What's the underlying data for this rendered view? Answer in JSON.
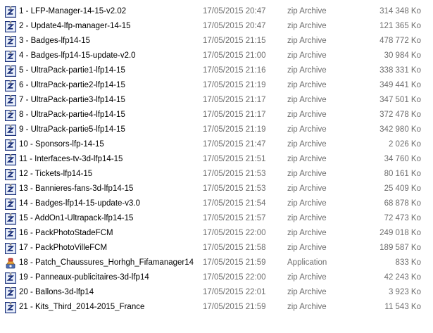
{
  "files": [
    {
      "name": "1 - LFP-Manager-14-15-v2.02",
      "date": "17/05/2015 20:47",
      "type": "zip Archive",
      "size": "314 348 Ko",
      "icon": "zip-archive-icon"
    },
    {
      "name": "2 - Update4-lfp-manager-14-15",
      "date": "17/05/2015 20:47",
      "type": "zip Archive",
      "size": "121 365 Ko",
      "icon": "zip-archive-icon"
    },
    {
      "name": "3 - Badges-lfp14-15",
      "date": "17/05/2015 21:15",
      "type": "zip Archive",
      "size": "478 772 Ko",
      "icon": "zip-archive-icon"
    },
    {
      "name": "4 - Badges-lfp14-15-update-v2.0",
      "date": "17/05/2015 21:00",
      "type": "zip Archive",
      "size": "30 984 Ko",
      "icon": "zip-archive-icon"
    },
    {
      "name": "5 - UltraPack-partie1-lfp14-15",
      "date": "17/05/2015 21:16",
      "type": "zip Archive",
      "size": "338 331 Ko",
      "icon": "zip-archive-icon"
    },
    {
      "name": "6 - UltraPack-partie2-lfp14-15",
      "date": "17/05/2015 21:19",
      "type": "zip Archive",
      "size": "349 441 Ko",
      "icon": "zip-archive-icon"
    },
    {
      "name": "7 - UltraPack-partie3-lfp14-15",
      "date": "17/05/2015 21:17",
      "type": "zip Archive",
      "size": "347 501 Ko",
      "icon": "zip-archive-icon"
    },
    {
      "name": "8 - UltraPack-partie4-lfp14-15",
      "date": "17/05/2015 21:17",
      "type": "zip Archive",
      "size": "372 478 Ko",
      "icon": "zip-archive-icon"
    },
    {
      "name": "9 - UltraPack-partie5-lfp14-15",
      "date": "17/05/2015 21:19",
      "type": "zip Archive",
      "size": "342 980 Ko",
      "icon": "zip-archive-icon"
    },
    {
      "name": "10 - Sponsors-lfp-14-15",
      "date": "17/05/2015 21:47",
      "type": "zip Archive",
      "size": "2 026 Ko",
      "icon": "zip-archive-icon"
    },
    {
      "name": "11 - Interfaces-tv-3d-lfp14-15",
      "date": "17/05/2015 21:51",
      "type": "zip Archive",
      "size": "34 760 Ko",
      "icon": "zip-archive-icon"
    },
    {
      "name": "12 - Tickets-lfp14-15",
      "date": "17/05/2015 21:53",
      "type": "zip Archive",
      "size": "80 161 Ko",
      "icon": "zip-archive-icon"
    },
    {
      "name": "13 - Bannieres-fans-3d-lfp14-15",
      "date": "17/05/2015 21:53",
      "type": "zip Archive",
      "size": "25 409 Ko",
      "icon": "zip-archive-icon"
    },
    {
      "name": "14 - Badges-lfp14-15-update-v3.0",
      "date": "17/05/2015 21:54",
      "type": "zip Archive",
      "size": "68 878 Ko",
      "icon": "zip-archive-icon"
    },
    {
      "name": "15 - AddOn1-Ultrapack-lfp14-15",
      "date": "17/05/2015 21:57",
      "type": "zip Archive",
      "size": "72 473 Ko",
      "icon": "zip-archive-icon"
    },
    {
      "name": "16 - PackPhotoStadeFCM",
      "date": "17/05/2015 22:00",
      "type": "zip Archive",
      "size": "249 018 Ko",
      "icon": "zip-archive-icon"
    },
    {
      "name": "17 - PackPhotoVilleFCM",
      "date": "17/05/2015 21:58",
      "type": "zip Archive",
      "size": "189 587 Ko",
      "icon": "zip-archive-icon"
    },
    {
      "name": "18 - Patch_Chaussures_Horhgh_Fifamanager14",
      "date": "17/05/2015 21:59",
      "type": "Application",
      "size": "833 Ko",
      "icon": "application-icon"
    },
    {
      "name": "19 - Panneaux-publicitaires-3d-lfp14",
      "date": "17/05/2015 22:00",
      "type": "zip Archive",
      "size": "42 243 Ko",
      "icon": "zip-archive-icon"
    },
    {
      "name": "20 - Ballons-3d-lfp14",
      "date": "17/05/2015 22:01",
      "type": "zip Archive",
      "size": "3 923 Ko",
      "icon": "zip-archive-icon"
    },
    {
      "name": "21 - Kits_Third_2014-2015_France",
      "date": "17/05/2015 21:59",
      "type": "zip Archive",
      "size": "11 543 Ko",
      "icon": "zip-archive-icon"
    }
  ]
}
